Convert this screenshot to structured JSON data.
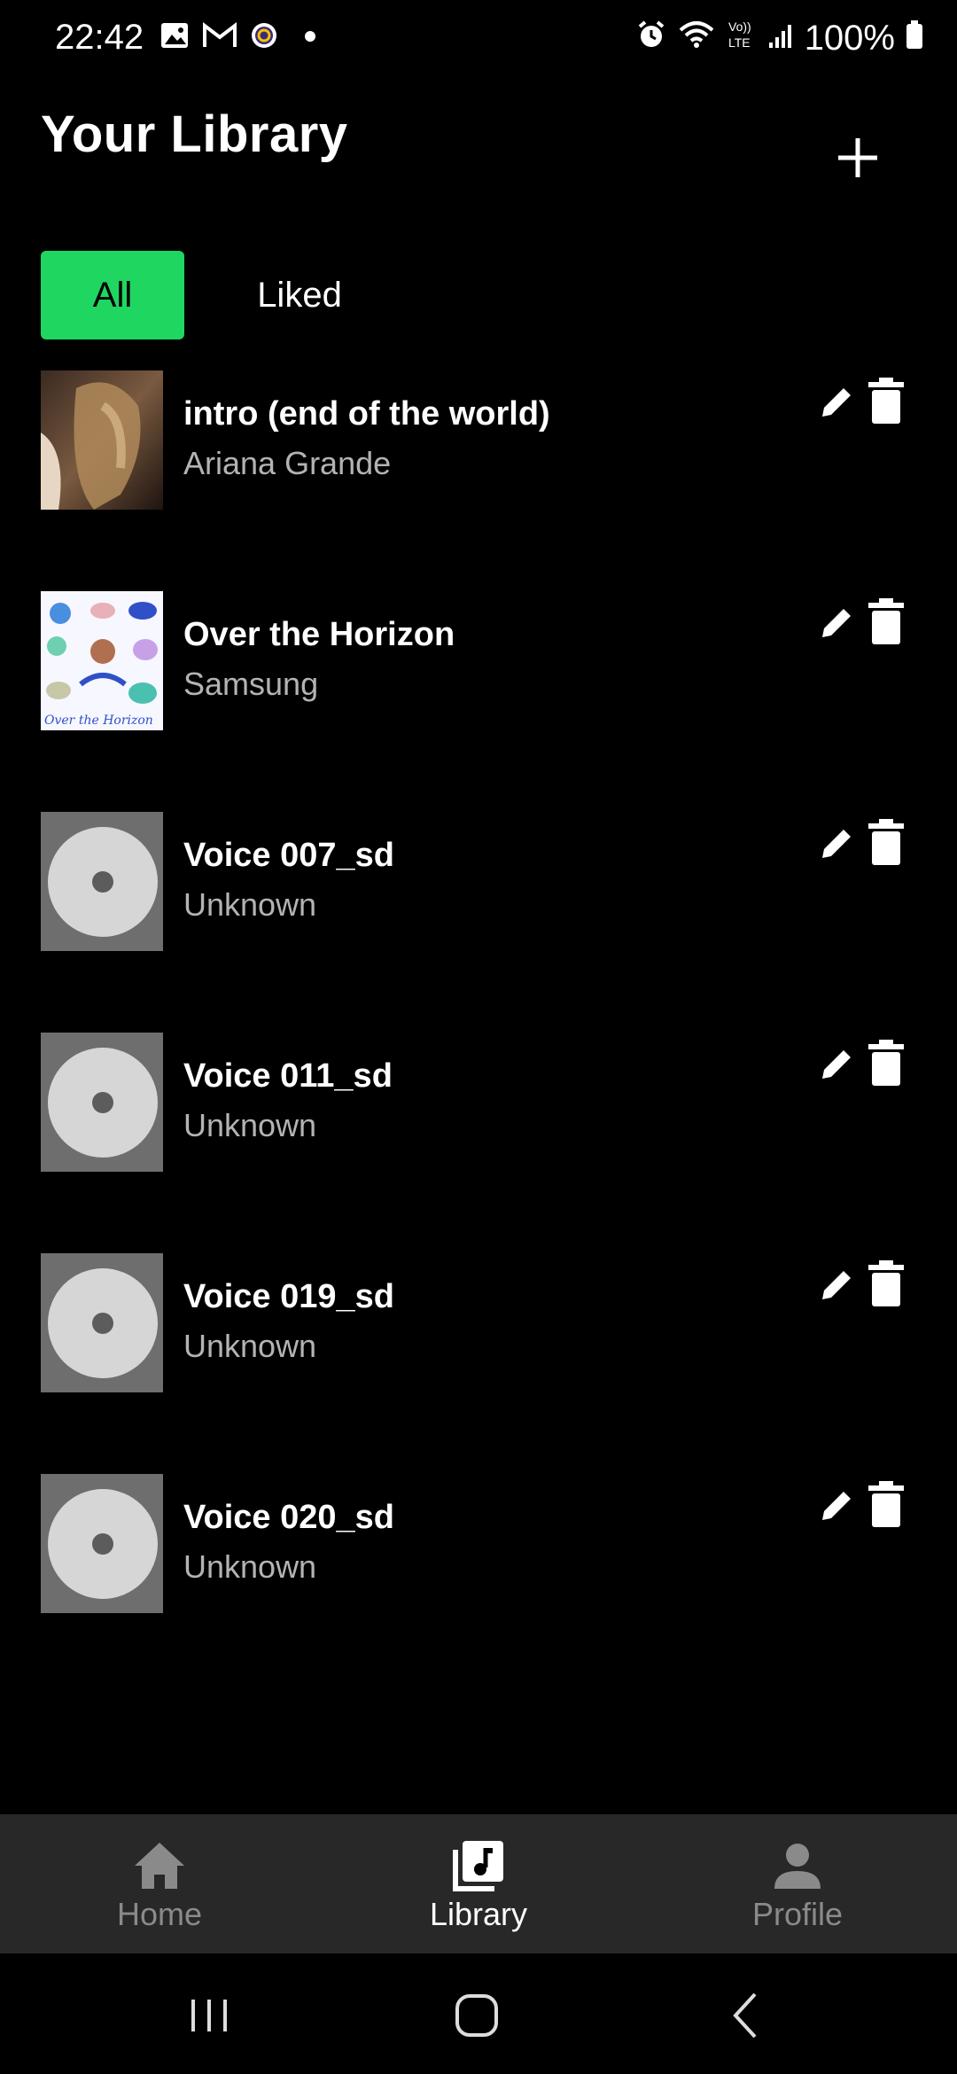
{
  "status_bar": {
    "time": "22:42",
    "battery": "100%",
    "left_icons": [
      "image-icon",
      "gmail-icon",
      "circle-app-icon",
      "dot-icon"
    ],
    "right_icons": [
      "alarm-icon",
      "wifi-icon",
      "volte-icon",
      "signal-icon",
      "battery-icon"
    ]
  },
  "header": {
    "title": "Your Library",
    "add_icon": "plus-icon"
  },
  "tabs": [
    {
      "label": "All",
      "selected": true
    },
    {
      "label": "Liked",
      "selected": false
    }
  ],
  "songs": [
    {
      "title": "intro (end of the world)",
      "artist": "Ariana Grande",
      "art": "photo"
    },
    {
      "title": "Over the Horizon",
      "artist": "Samsung",
      "art": "illustration"
    },
    {
      "title": "Voice 007_sd",
      "artist": "Unknown",
      "art": "default-disc"
    },
    {
      "title": "Voice 011_sd",
      "artist": "Unknown",
      "art": "default-disc"
    },
    {
      "title": "Voice 019_sd",
      "artist": "Unknown",
      "art": "default-disc"
    },
    {
      "title": "Voice 020_sd",
      "artist": "Unknown",
      "art": "default-disc"
    }
  ],
  "row_icons": {
    "edit": "pencil-icon",
    "delete": "trash-icon"
  },
  "bottom_nav": [
    {
      "label": "Home",
      "icon": "home-icon",
      "active": false
    },
    {
      "label": "Library",
      "icon": "library-icon",
      "active": true
    },
    {
      "label": "Profile",
      "icon": "profile-icon",
      "active": false
    }
  ],
  "colors": {
    "accent": "#1fd760",
    "background": "#000000",
    "nav_background": "#282828",
    "inactive_nav": "#8a8a8a",
    "secondary_text": "#b3b3b3"
  }
}
